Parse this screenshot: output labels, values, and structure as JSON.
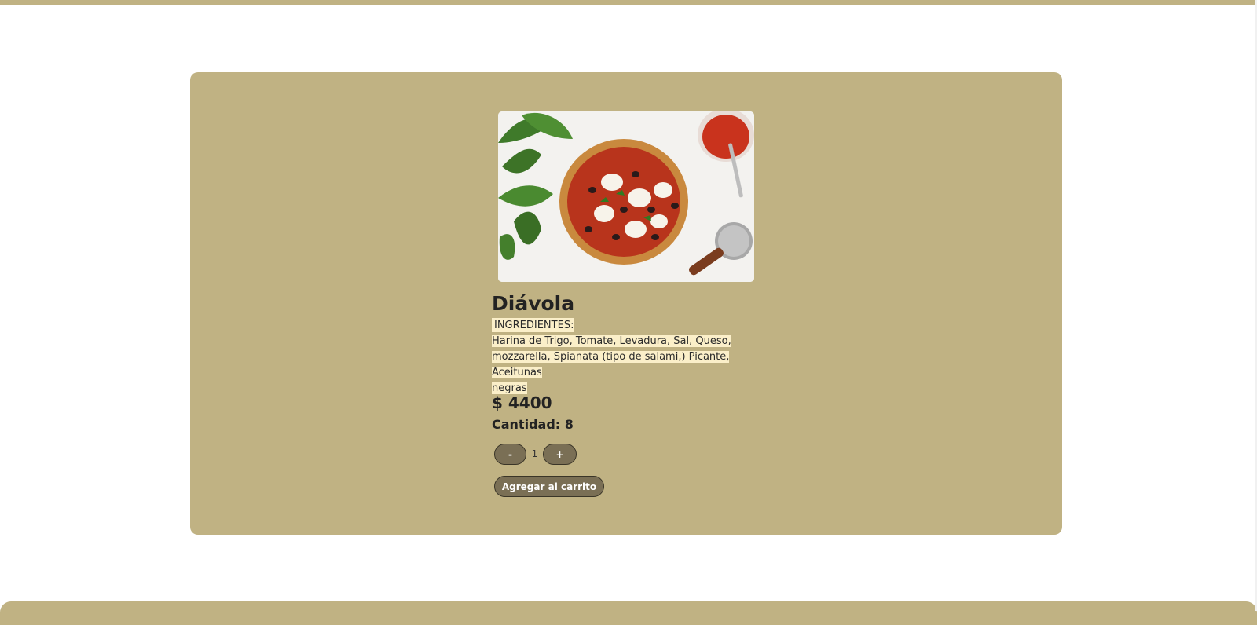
{
  "product": {
    "name": "Diávola",
    "image_alt": "Pizza Diávola",
    "ingredients_heading": "INGREDIENTES:",
    "ingredients_lines": [
      "Harina de Trigo, Tomate, Levadura, Sal, Queso,",
      "mozzarella, Spianata (tipo de salami,) Picante, Aceitunas",
      "negras"
    ],
    "price": "$ 4400",
    "stock": "Cantidad: 8"
  },
  "controls": {
    "decrement_label": "-",
    "increment_label": "+",
    "quantity_value": "1",
    "add_to_cart_label": "Agregar al carrito"
  },
  "colors": {
    "card_background": "#c0b283",
    "button_background": "#7a6f55",
    "text_highlight": "#fbefc9",
    "page_background": "#ffffff"
  }
}
